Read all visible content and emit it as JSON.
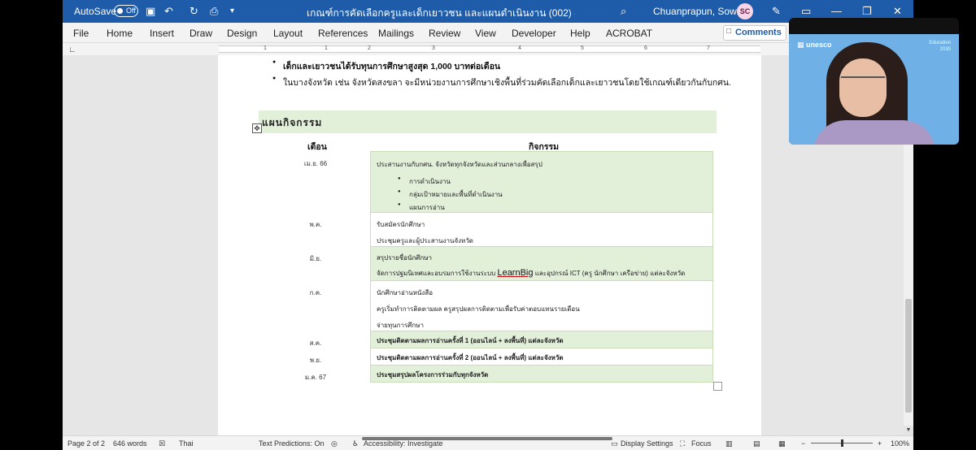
{
  "titlebar": {
    "autosave_label": "AutoSave",
    "autosave_state": "Off",
    "doc_title": "เกณฑ์การคัดเลือกครูและเด็กเยาวชน และแผนดำเนินงาน (002)  -  Read-Only",
    "user_name": "Chuanprapun, Sowirin",
    "avatar_initials": "SC",
    "accent_color": "#1e5ba8"
  },
  "ribbon": {
    "tabs": [
      "File",
      "Home",
      "Insert",
      "Draw",
      "Design",
      "Layout",
      "References",
      "Mailings",
      "Review",
      "View",
      "Developer",
      "Help",
      "ACROBAT"
    ],
    "comments_label": "Comments"
  },
  "ruler": {
    "numbers": [
      "1",
      "1",
      "2",
      "3",
      "4",
      "5",
      "6",
      "7"
    ]
  },
  "document": {
    "bullets": [
      "เด็กและเยาวชนได้รับทุนการศึกษาสูงสุด 1,000 บาทต่อเดือน",
      "ในบางจังหวัด เช่น จังหวัดสงขลา จะมีหน่วยงานการศึกษาเชิงพื้นที่ร่วมคัดเลือกเด็กและเยาวชนโดยใช้เกณฑ์เดียวกันกับกศน."
    ],
    "section_heading": "แผนกิจกรรม",
    "table": {
      "headers": {
        "month": "เดือน",
        "activity": "กิจกรรม"
      },
      "rows": [
        {
          "month": "เม.ย. 66",
          "lines": [
            "ประสานงานกับกศน. จังหวัดทุกจังหวัดและส่วนกลางเพื่อสรุป"
          ],
          "subitems": [
            "การดำเนินงาน",
            "กลุ่มเป้าหมายและพื้นที่ดำเนินงาน",
            "แผนการอ่าน"
          ]
        },
        {
          "month": "พ.ค.",
          "lines": [
            "รับสมัครนักศึกษา",
            "ประชุมครูและผู้ประสานงานจังหวัด"
          ]
        },
        {
          "month": "มิ.ย.",
          "lines": [
            "สรุปรายชื่อนักศึกษา"
          ],
          "line2_prefix": "จัดการปฐมนิเทศและอบรมการใช้งานระบบ ",
          "line2_link": "LearnBig",
          "line2_suffix": " และอุปกรณ์ ICT (ครู นักศึกษา เครือข่าย) แต่ละจังหวัด"
        },
        {
          "month": "ก.ค.",
          "lines": [
            "นักศึกษาอ่านหนังสือ",
            "ครูเริ่มทำการติดตามผล ครูสรุปผลการติดตามเพื่อรับค่าตอบแทนรายเดือน",
            "จ่ายทุนการศึกษา"
          ]
        },
        {
          "month": "ส.ค.",
          "lines": [
            "ประชุมติดตามผลการอ่านครั้งที่ 1 (ออนไลน์ + ลงพื้นที่) แต่ละจังหวัด"
          ]
        },
        {
          "month": "พ.ย.",
          "lines": [
            "ประชุมติดตามผลการอ่านครั้งที่ 2 (ออนไลน์ + ลงพื้นที่) แต่ละจังหวัด"
          ]
        },
        {
          "month": "ม.ค. 67",
          "lines": [
            "ประชุมสรุปผลโครงการร่วมกับทุกจังหวัด"
          ]
        }
      ],
      "row_fill": "#e2efd9"
    }
  },
  "statusbar": {
    "page": "Page 2 of 2",
    "words": "646 words",
    "language": "Thai",
    "text_predictions": "Text Predictions: On",
    "accessibility": "Accessibility: Investigate",
    "display_settings": "Display Settings",
    "focus": "Focus",
    "zoom": "100%",
    "zoom_minus": "−",
    "zoom_plus": "+"
  },
  "video": {
    "org_label": "unesco",
    "badge_line1": "Education",
    "badge_line2": "2030"
  }
}
